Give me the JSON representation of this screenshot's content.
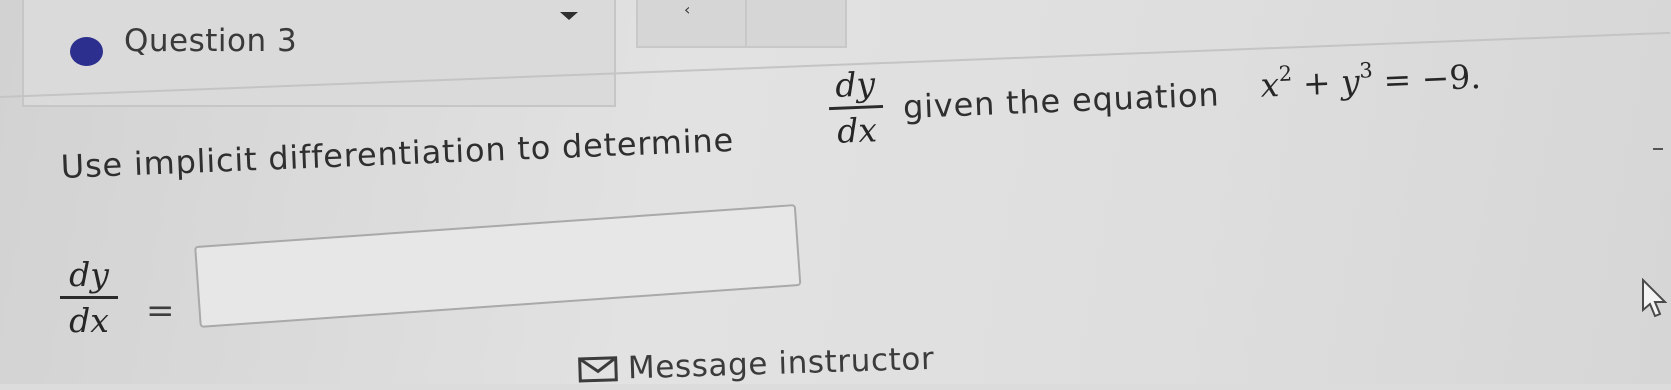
{
  "question": {
    "title": "Question 3",
    "status": "unanswered"
  },
  "prompt": {
    "before": "Use implicit differentiation to determine",
    "derivative_num": "dy",
    "derivative_den": "dx",
    "after": "given the equation",
    "equation": {
      "x": "x",
      "x_power": "2",
      "plus": "+",
      "y": "y",
      "y_power": "3",
      "rhs": "= −9."
    }
  },
  "answer": {
    "lhs_num": "dy",
    "lhs_den": "dx",
    "equals": "=",
    "value": ""
  },
  "footer": {
    "message_label": "Message instructor"
  },
  "icons": {
    "status": "status-dot-icon",
    "dropdown": "chevron-down-icon",
    "nav": "chevron-left-icon",
    "mail": "mail-icon",
    "cursor": "pointer-cursor-icon"
  },
  "colors": {
    "status_dot": "#2c2f8e",
    "background": "#dcdcdc"
  }
}
